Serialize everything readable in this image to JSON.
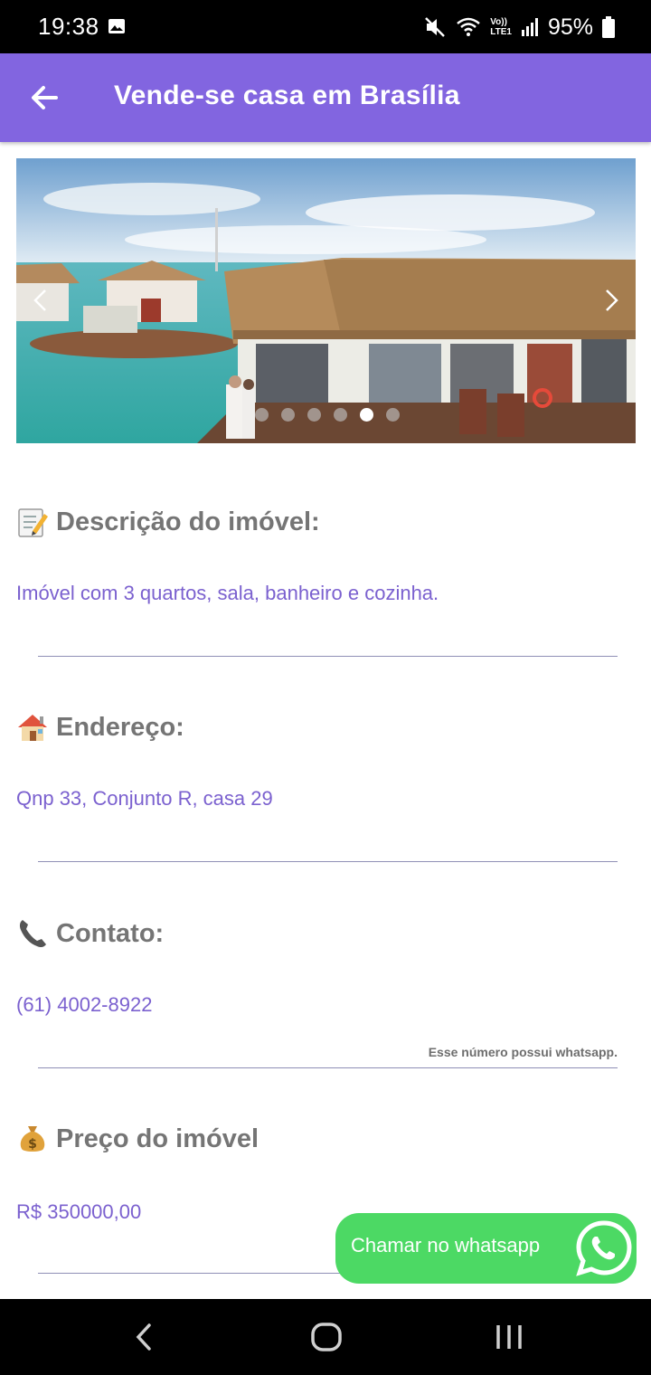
{
  "status_bar": {
    "time": "19:38",
    "battery": "95%",
    "icons": [
      "gallery-icon",
      "mute-icon",
      "wifi-icon",
      "volte-icon",
      "signal-icon",
      "battery-icon"
    ],
    "volte_top": "Vo))",
    "volte_bottom": "LTE1"
  },
  "app_bar": {
    "title": "Vende-se casa em Brasília",
    "back_icon": "arrow-left-icon",
    "color": "#8265e0"
  },
  "carousel": {
    "slide_count": 6,
    "active_index": 4,
    "prev_icon": "chevron-left-icon",
    "next_icon": "chevron-right-icon"
  },
  "sections": {
    "description": {
      "icon": "memo-icon",
      "title": "Descrição do imóvel:",
      "value": "Imóvel com 3 quartos, sala, banheiro e cozinha."
    },
    "address": {
      "icon": "house-icon",
      "title": "Endereço:",
      "value": "Qnp 33, Conjunto R, casa 29"
    },
    "contact": {
      "icon": "telephone-icon",
      "title": "Contato:",
      "value": "(61) 4002-8922",
      "note": "Esse número possui whatsapp."
    },
    "price": {
      "icon": "money-bag-icon",
      "title": "Preço do imóvel",
      "value": "R$ 350000,00"
    }
  },
  "whatsapp_button": {
    "label": "Chamar no whatsapp",
    "icon": "whatsapp-icon",
    "color": "#4cd964"
  },
  "nav_bar": {
    "items": [
      "back-nav-icon",
      "home-nav-icon",
      "recents-nav-icon"
    ]
  },
  "colors": {
    "accent": "#8265e0",
    "value_text": "#7b61cf",
    "heading_text": "#757575"
  }
}
